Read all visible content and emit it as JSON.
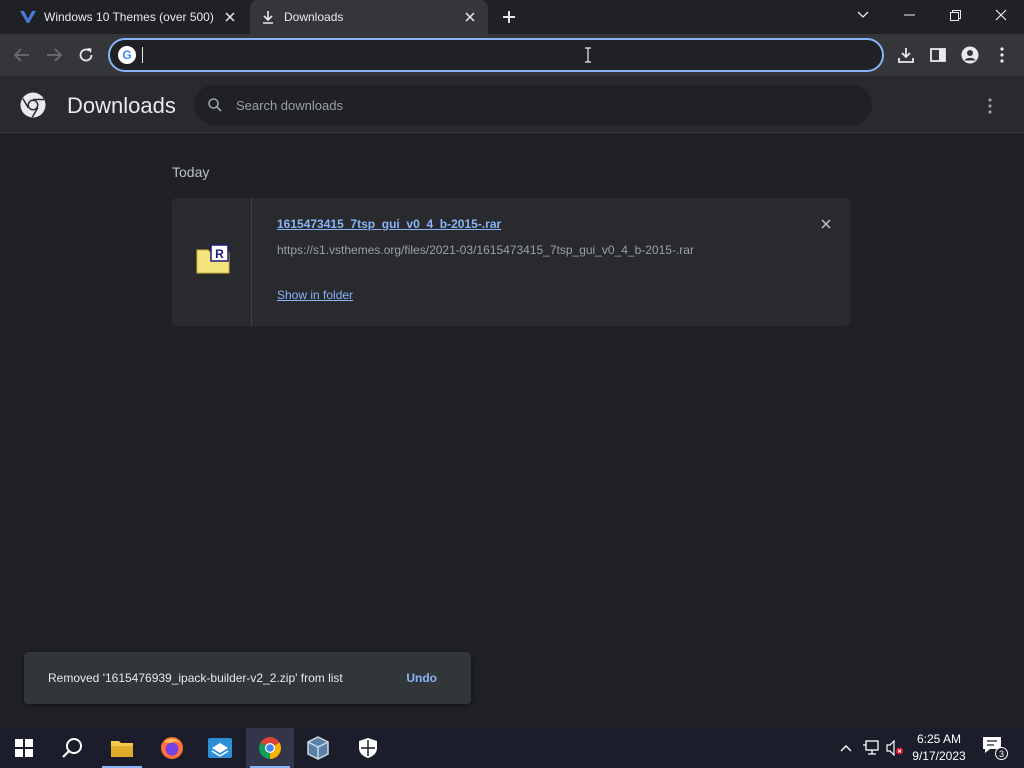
{
  "browser": {
    "tabs": [
      {
        "title": "Windows 10 Themes (over 500)",
        "icon": "vsthemes-icon",
        "active": false
      },
      {
        "title": "Downloads",
        "icon": "download-icon",
        "active": true
      }
    ],
    "omnibox": {
      "value": "",
      "placeholder": ""
    }
  },
  "downloads_page": {
    "title": "Downloads",
    "search_placeholder": "Search downloads",
    "sections": [
      {
        "label": "Today",
        "items": [
          {
            "filename": "1615473415_7tsp_gui_v0_4_b-2015-.rar",
            "url": "https://s1.vsthemes.org/files/2021-03/1615473415_7tsp_gui_v0_4_b-2015-.rar",
            "action": "Show in folder",
            "icon": "rar-archive-icon"
          }
        ]
      }
    ]
  },
  "toast": {
    "message": "Removed '1615476939_ipack-builder-v2_2.zip' from list",
    "action": "Undo"
  },
  "taskbar": {
    "apps": [
      "start",
      "search",
      "file-explorer",
      "firefox",
      "sandbox",
      "chrome",
      "virtualbox",
      "security"
    ],
    "active_app": "chrome",
    "clock": {
      "time": "6:25 AM",
      "date": "9/17/2023"
    },
    "notification_count": "3"
  },
  "colors": {
    "accent": "#8ab4f8",
    "background": "#202124",
    "surface": "#292a2d",
    "taskbar": "#1b1d2a"
  }
}
